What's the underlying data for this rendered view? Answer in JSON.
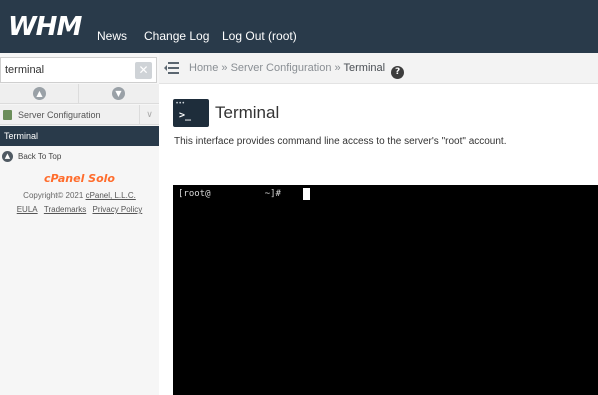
{
  "header": {
    "logo": "WHM",
    "nav": [
      "News",
      "Change Log",
      "Log Out (root)"
    ]
  },
  "sidebar": {
    "search_value": "terminal",
    "clear_icon": "clear-x-icon",
    "category_label": "Server Configuration",
    "active_item": "Terminal",
    "back_to_top": "Back To Top",
    "brand": "cPanel Solo",
    "copyright_prefix": "Copyright© 2021",
    "copyright_link": "cPanel, L.L.C.",
    "links": [
      "EULA",
      "Trademarks",
      "Privacy Policy"
    ]
  },
  "breadcrumb": {
    "home": "Home",
    "sep": "»",
    "section": "Server Configuration",
    "current": "Terminal",
    "help": "?"
  },
  "main": {
    "title": "Terminal",
    "description": "This interface provides command line access to the server's \"root\" account.",
    "icon_prompt": ">_"
  },
  "terminal": {
    "prompt": "[root@          ~]#"
  },
  "colors": {
    "topbar": "#293a4a",
    "brand": "#ff6c2c",
    "terminal_bg": "#000000"
  }
}
